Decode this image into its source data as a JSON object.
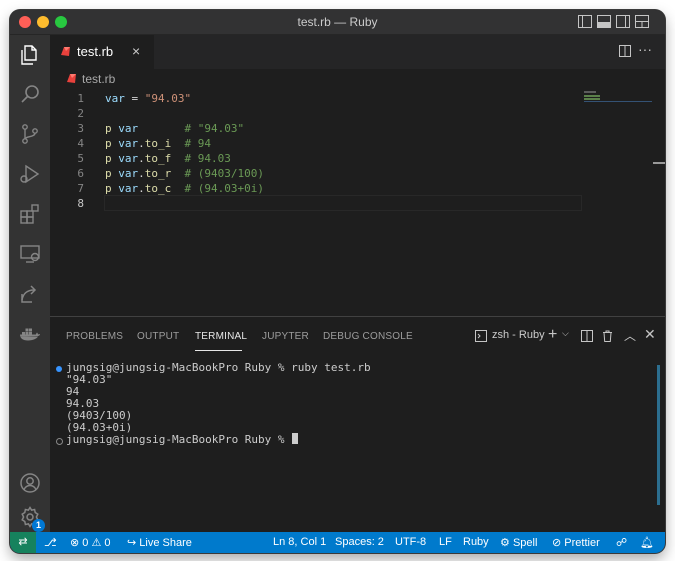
{
  "window": {
    "title": "test.rb — Ruby"
  },
  "tab": {
    "filename": "test.rb",
    "close": "×"
  },
  "breadcrumb": {
    "file": "test.rb"
  },
  "editor": {
    "lines": [
      {
        "num": "1",
        "tokens": [
          {
            "t": "var",
            "c": "kw"
          },
          {
            "t": " = ",
            "c": "op"
          },
          {
            "t": "\"94.03\"",
            "c": "str"
          }
        ]
      },
      {
        "num": "2",
        "tokens": []
      },
      {
        "num": "3",
        "tokens": [
          {
            "t": "p ",
            "c": "method"
          },
          {
            "t": "var",
            "c": "kw"
          },
          {
            "t": "       ",
            "c": "op"
          },
          {
            "t": "# \"94.03\"",
            "c": "cm"
          }
        ]
      },
      {
        "num": "4",
        "tokens": [
          {
            "t": "p ",
            "c": "method"
          },
          {
            "t": "var",
            "c": "kw"
          },
          {
            "t": ".",
            "c": "op"
          },
          {
            "t": "to_i",
            "c": "method"
          },
          {
            "t": "  ",
            "c": "op"
          },
          {
            "t": "# 94",
            "c": "cm"
          }
        ]
      },
      {
        "num": "5",
        "tokens": [
          {
            "t": "p ",
            "c": "method"
          },
          {
            "t": "var",
            "c": "kw"
          },
          {
            "t": ".",
            "c": "op"
          },
          {
            "t": "to_f",
            "c": "method"
          },
          {
            "t": "  ",
            "c": "op"
          },
          {
            "t": "# 94.03",
            "c": "cm"
          }
        ]
      },
      {
        "num": "6",
        "tokens": [
          {
            "t": "p ",
            "c": "method"
          },
          {
            "t": "var",
            "c": "kw"
          },
          {
            "t": ".",
            "c": "op"
          },
          {
            "t": "to_r",
            "c": "method"
          },
          {
            "t": "  ",
            "c": "op"
          },
          {
            "t": "# (9403/100)",
            "c": "cm"
          }
        ]
      },
      {
        "num": "7",
        "tokens": [
          {
            "t": "p ",
            "c": "method"
          },
          {
            "t": "var",
            "c": "kw"
          },
          {
            "t": ".",
            "c": "op"
          },
          {
            "t": "to_c",
            "c": "method"
          },
          {
            "t": "  ",
            "c": "op"
          },
          {
            "t": "# (94.03+0i)",
            "c": "cm"
          }
        ]
      },
      {
        "num": "8",
        "tokens": []
      }
    ]
  },
  "panel": {
    "tabs": [
      "PROBLEMS",
      "OUTPUT",
      "TERMINAL",
      "JUPYTER",
      "DEBUG CONSOLE"
    ],
    "active_tab": "TERMINAL",
    "terminal_selector": "zsh - Ruby",
    "terminal": {
      "command_line": "jungsig@jungsig-MacBookPro Ruby % ruby test.rb",
      "output": [
        "\"94.03\"",
        "94",
        "94.03",
        "(9403/100)",
        "(94.03+0i)"
      ],
      "prompt": "jungsig@jungsig-MacBookPro Ruby % "
    }
  },
  "statusbar": {
    "errors": "0",
    "warnings": "0",
    "live_share": "Live Share",
    "position": "Ln 8, Col 1",
    "spaces": "Spaces: 2",
    "encoding": "UTF-8",
    "eol": "LF",
    "language": "Ruby",
    "spell": "Spell",
    "prettier": "Prettier"
  },
  "badges": {
    "accounts_settings": "1"
  },
  "colors": {
    "status_bar": "#007acc",
    "remote": "#16825d",
    "ruby_icon": "#e8413c",
    "comment": "#6a9955",
    "string": "#ce9178",
    "variable": "#9cdcfe"
  }
}
